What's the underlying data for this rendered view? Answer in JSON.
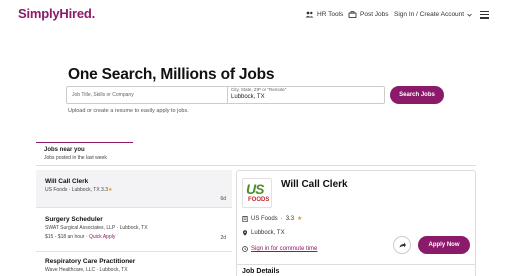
{
  "header": {
    "logo": "SimplyHired",
    "logo_dot": ".",
    "hr_tools": "HR Tools",
    "post_jobs": "Post Jobs",
    "sign_in": "Sign In / Create Account",
    "icons": [
      "people-icon",
      "post-jobs-icon",
      "chevron-down-icon",
      "menu-icon"
    ]
  },
  "hero": {
    "title": "One Search, Millions of Jobs",
    "query_placeholder": "Job Title, Skills or Company",
    "location_label": "City, State, ZIP or \"Remote\"",
    "location_value": "Lubbock, TX",
    "search_button": "Search Jobs",
    "upload_note": "Upload or create a resume to easily apply to jobs."
  },
  "tab": {
    "title": "Jobs near you",
    "subtitle": "Jobs posted in the last week"
  },
  "jobs": [
    {
      "title": "Will Call Clerk",
      "meta": "US Foods · Lubbock, TX",
      "rating": "3.3",
      "star": "★",
      "age": "6d"
    },
    {
      "title": "Surgery Scheduler",
      "meta": "SWAT Surgical Associates, LLP · Lubbock, TX",
      "salary": "$15 - $18 an hour",
      "quick": "Quick Apply",
      "age": "2d"
    },
    {
      "title": "Respiratory Care Practitioner",
      "meta": "Wave Healthcare, LLC · Lubbock, TX"
    }
  ],
  "detail": {
    "logo_text_1": "US",
    "logo_text_2": "FOODS",
    "title": "Will Call Clerk",
    "company": "US Foods",
    "rating": "3.3",
    "star": "★",
    "location": "Lubbock, TX",
    "commute": "Sign in for commute time",
    "apply": "Apply Now",
    "section": "Job Details"
  },
  "colors": {
    "brand": "#8b1a6b",
    "star": "#e39a1c"
  }
}
